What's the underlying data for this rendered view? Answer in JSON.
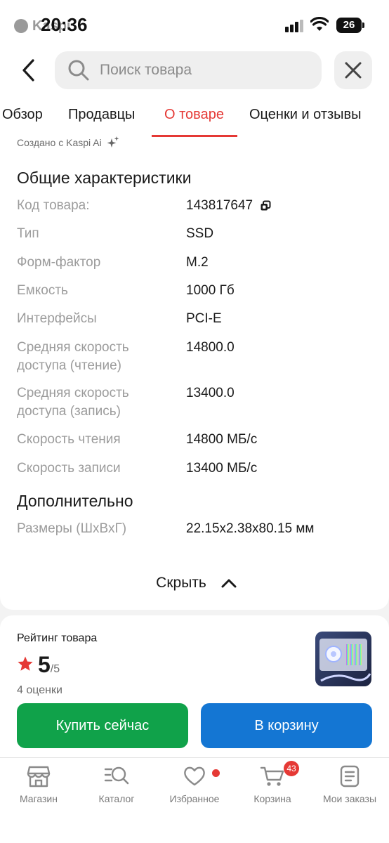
{
  "status_bar": {
    "time": "20:36",
    "back_app": "Kaspi",
    "battery": "26"
  },
  "search": {
    "placeholder": "Поиск товара"
  },
  "tabs": [
    {
      "label": "Обзор"
    },
    {
      "label": "Продавцы"
    },
    {
      "label": "О товаре",
      "active": true
    },
    {
      "label": "Оценки и отзывы"
    }
  ],
  "ai_note": "Создано с Kaspi Ai",
  "general": {
    "title": "Общие характеристики",
    "specs": [
      {
        "label": "Код товара:",
        "value": "143817647"
      },
      {
        "label": "Тип",
        "value": "SSD"
      },
      {
        "label": "Форм-фактор",
        "value": "M.2"
      },
      {
        "label": "Емкость",
        "value": "1000 Гб"
      },
      {
        "label": "Интерфейсы",
        "value": "PCI-E"
      },
      {
        "label": "Средняя скорость доступа (чтение)",
        "value": "14800.0"
      },
      {
        "label": "Средняя скорость доступа (запись)",
        "value": "13400.0"
      },
      {
        "label": "Скорость чтения",
        "value": "14800 МБ/с"
      },
      {
        "label": "Скорость записи",
        "value": "13400 МБ/с"
      }
    ]
  },
  "additional": {
    "title": "Дополнительно",
    "specs": [
      {
        "label": "Размеры (ШхВхГ)",
        "value": "22.15x2.38x80.15 мм"
      }
    ]
  },
  "hide_label": "Скрыть",
  "rating": {
    "title": "Рейтинг товара",
    "value": "5",
    "max": "/5",
    "count": "4 оценки"
  },
  "actions": {
    "buy": "Купить сейчас",
    "cart": "В корзину"
  },
  "nav": [
    {
      "label": "Магазин",
      "icon": "shop-icon"
    },
    {
      "label": "Каталог",
      "icon": "catalog-search-icon"
    },
    {
      "label": "Избранное",
      "icon": "heart-icon"
    },
    {
      "label": "Корзина",
      "icon": "cart-icon",
      "badge": "43"
    },
    {
      "label": "Мои заказы",
      "icon": "orders-icon"
    }
  ],
  "colors": {
    "accent_red": "#e53935",
    "buy_green": "#10a24a",
    "cart_blue": "#1476d3"
  }
}
